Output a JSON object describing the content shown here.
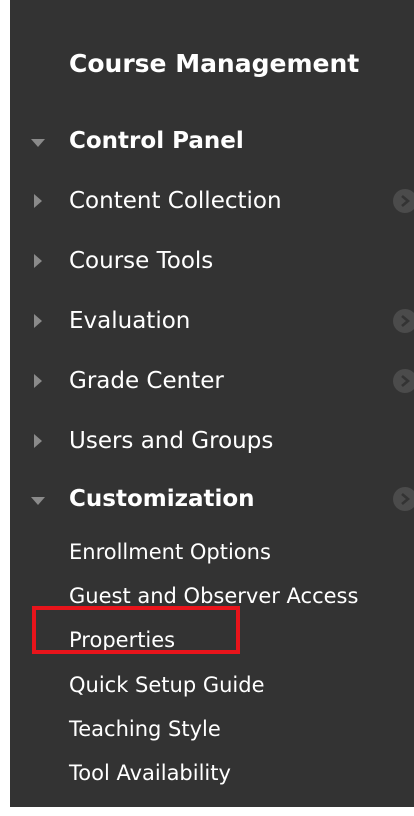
{
  "panel": {
    "title": "Course Management",
    "control_panel": {
      "label": "Control Panel",
      "items": [
        {
          "label": "Content Collection"
        },
        {
          "label": "Course Tools"
        },
        {
          "label": "Evaluation"
        },
        {
          "label": "Grade Center"
        },
        {
          "label": "Users and Groups"
        }
      ]
    },
    "customization": {
      "label": "Customization",
      "items": [
        {
          "label": "Enrollment Options"
        },
        {
          "label": "Guest and Observer Access"
        },
        {
          "label": "Properties"
        },
        {
          "label": "Quick Setup Guide"
        },
        {
          "label": "Teaching Style"
        },
        {
          "label": "Tool Availability"
        }
      ]
    }
  },
  "colors": {
    "panel_background": "#333333",
    "text": "#ffffff",
    "arrow": "#8a8a8a",
    "highlight": "#e8141b"
  },
  "icons": {
    "expanded": "triangle-down-icon",
    "collapsed": "triangle-right-icon",
    "options": "options-circle-icon"
  }
}
